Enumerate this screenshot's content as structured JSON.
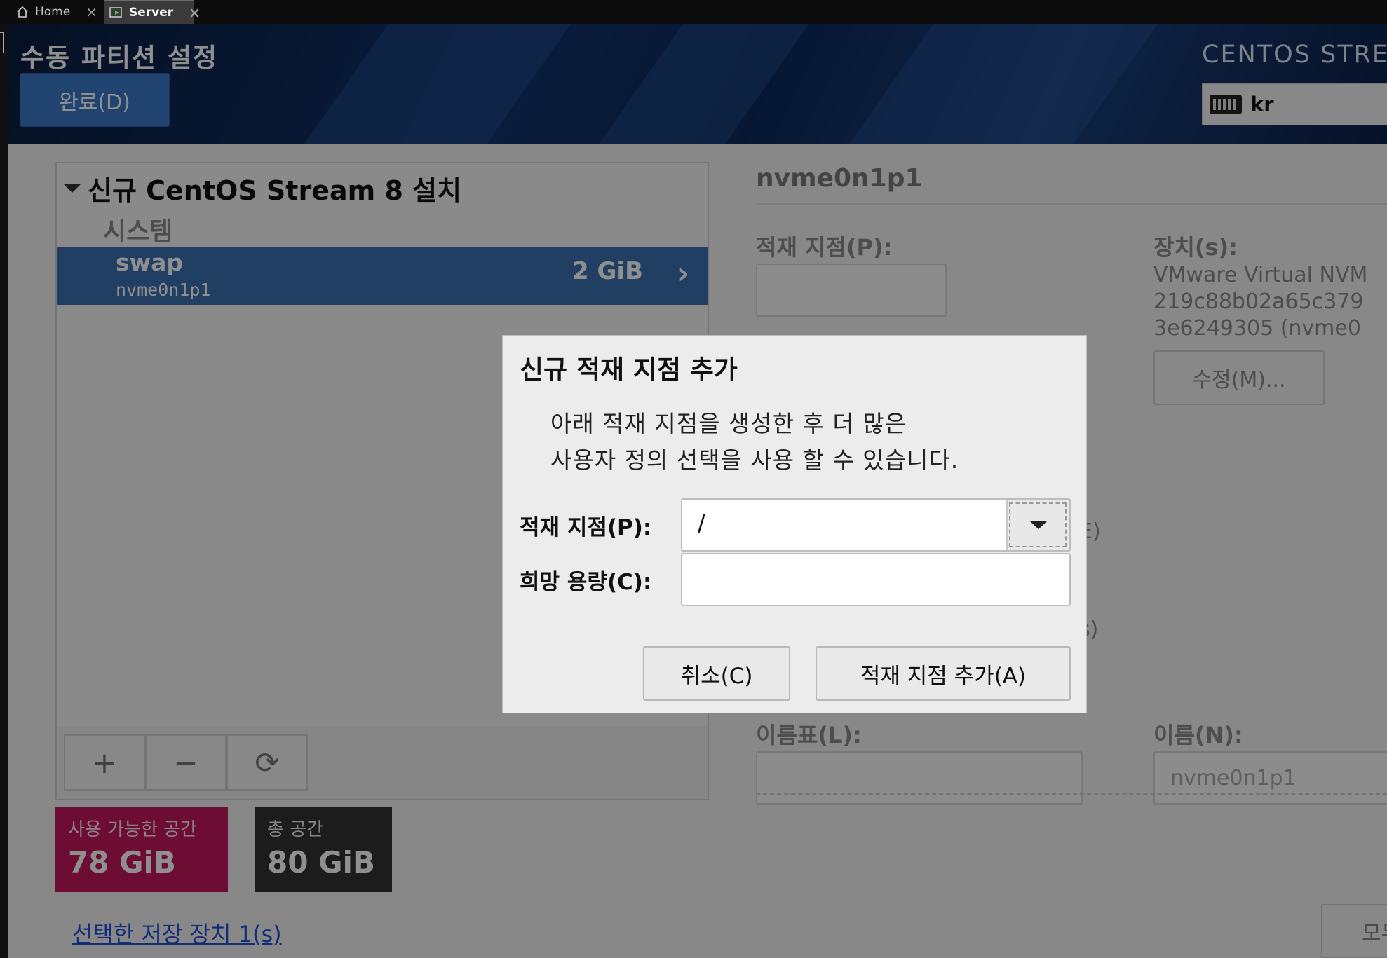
{
  "tabs": [
    {
      "label": "Home",
      "icon": "home-icon"
    },
    {
      "label": "Server",
      "icon": "vm-icon",
      "active": true
    }
  ],
  "header": {
    "title": "수동 파티션 설정",
    "done_button": "완료(D)",
    "brand": "CENTOS STRE",
    "keyboard_layout": "kr"
  },
  "left_panel": {
    "install_title": "신규 CentOS Stream 8 설치",
    "group_label": "시스템",
    "partitions": [
      {
        "name": "swap",
        "device": "nvme0n1p1",
        "size": "2 GiB"
      }
    ],
    "toolbar": {
      "add": "+",
      "remove": "−",
      "refresh": "⟳"
    }
  },
  "space": {
    "available_label": "사용 가능한 공간",
    "available_value": "78 GiB",
    "total_label": "총 공간",
    "total_value": "80 GiB"
  },
  "storage_link": "선택한 저장 장치 1(s)",
  "right_pane": {
    "title": "nvme0n1p1",
    "mount_label": "적재 지점(P):",
    "device_label": "장치(s):",
    "device_lines": [
      "VMware Virtual NVM",
      "219c88b02a65c379",
      "3e6249305 (nvme0"
    ],
    "modify_button": "수정(M)...",
    "partial_e": "E)",
    "partial_s": "s)",
    "label_label": "이름표(L):",
    "name_label": "이름(N):",
    "name_value": "nvme0n1p1",
    "bottom_button": "모두"
  },
  "dialog": {
    "title": "신규 적재 지점 추가",
    "message_line1": "아래 적재 지점을 생성한 후 더 많은",
    "message_line2": "사용자 정의 선택을 사용 할 수 있습니다.",
    "mount_label": "적재 지점(P):",
    "mount_value": "/",
    "capacity_label": "희망 용량(C):",
    "capacity_value": "",
    "cancel_button": "취소(C)",
    "add_button": "적재 지점 추가(A)"
  },
  "colors": {
    "selected_row": "#3b6fb0",
    "available_space": "#c2185b",
    "total_space": "#333333",
    "done_button": "#3a78c8",
    "link": "#1f4fd8"
  }
}
